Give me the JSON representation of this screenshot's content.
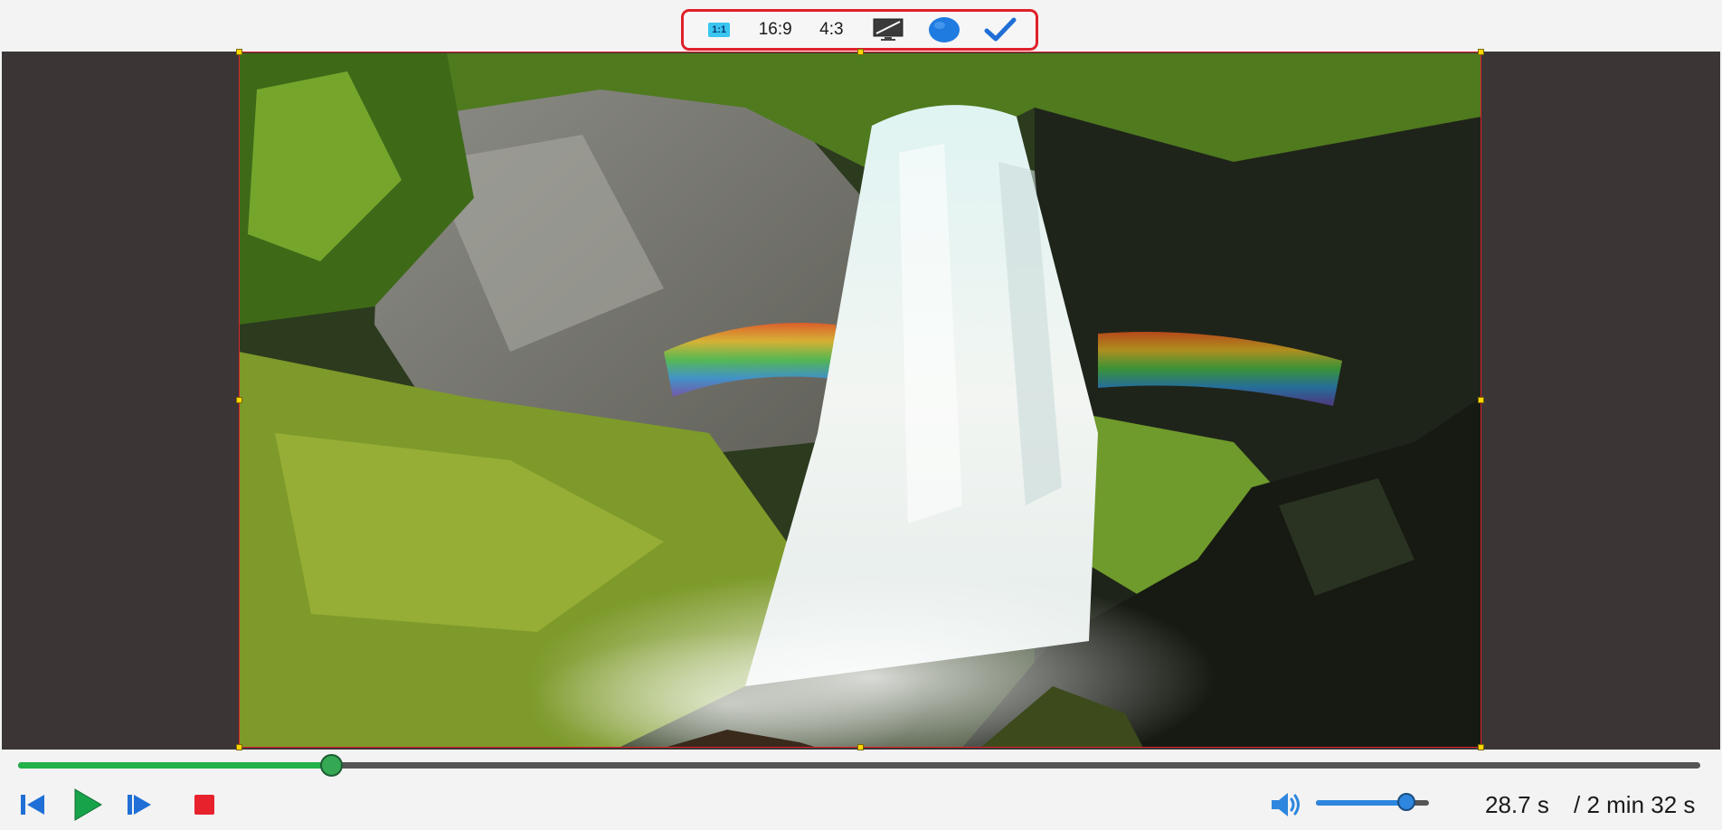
{
  "toolbar": {
    "ratio_1_1_label": "1:1",
    "ratio_16_9_label": "16:9",
    "ratio_4_3_label": "4:3"
  },
  "playback": {
    "current_time": "28.7 s",
    "total_time": "/ 2 min 32 s",
    "progress": 0.186,
    "volume": 0.8
  },
  "colors": {
    "crop_border": "#e0202a",
    "seek_fill": "#24b14a",
    "accent_blue": "#2e86de",
    "stop_red": "#e8222c"
  }
}
